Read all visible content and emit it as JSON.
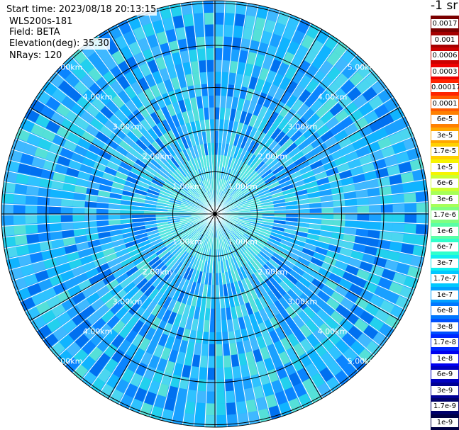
{
  "header": {
    "start_time": "Start time: 2023/08/18 20:13:15",
    "instrument": "WLS200s-181",
    "field": "Field: BETA",
    "elevation": "Elevation(deg): 35.30",
    "nrays": "NRays: 120"
  },
  "colorbar": {
    "unit_title": "-1 sr",
    "levels": [
      {
        "label": "0.0017",
        "color": "#7a0000"
      },
      {
        "label": "0.001",
        "color": "#a50000"
      },
      {
        "label": "0.0006",
        "color": "#cc0000"
      },
      {
        "label": "0.0003",
        "color": "#ee0000"
      },
      {
        "label": "0.00017",
        "color": "#ff2400"
      },
      {
        "label": "0.0001",
        "color": "#ff5a00"
      },
      {
        "label": "6e-5",
        "color": "#ff8000"
      },
      {
        "label": "3e-5",
        "color": "#ffa800"
      },
      {
        "label": "1.7e-5",
        "color": "#ffd000"
      },
      {
        "label": "1e-5",
        "color": "#f6f400"
      },
      {
        "label": "6e-6",
        "color": "#ccff30"
      },
      {
        "label": "3e-6",
        "color": "#a6ff58"
      },
      {
        "label": "1.7e-6",
        "color": "#80ff80"
      },
      {
        "label": "1e-6",
        "color": "#5affa6"
      },
      {
        "label": "6e-7",
        "color": "#30ffcc"
      },
      {
        "label": "3e-7",
        "color": "#10eef0"
      },
      {
        "label": "1.7e-7",
        "color": "#00c8ff"
      },
      {
        "label": "1e-7",
        "color": "#00a0ff"
      },
      {
        "label": "6e-8",
        "color": "#0078ff"
      },
      {
        "label": "3e-8",
        "color": "#0050ff"
      },
      {
        "label": "1.7e-8",
        "color": "#0028ff"
      },
      {
        "label": "1e-8",
        "color": "#0000f0"
      },
      {
        "label": "6e-9",
        "color": "#0000c0"
      },
      {
        "label": "3e-9",
        "color": "#000094"
      },
      {
        "label": "1.7e-9",
        "color": "#00006a"
      },
      {
        "label": "1e-9",
        "color": "#000044"
      }
    ]
  },
  "range_rings": {
    "labels": [
      "1.00km",
      "2.00km",
      "3.00km",
      "4.00km",
      "5.00km"
    ]
  },
  "spokes_deg": [
    0,
    30,
    60,
    90,
    120,
    150,
    180,
    210,
    240,
    270,
    300,
    330
  ],
  "rays": {
    "count": 120,
    "field_palette": [
      "#1aa0ff",
      "#0a84ff",
      "#2ec2ff",
      "#10b4ff",
      "#4bd6f0",
      "#55e0d8",
      "#0070f0",
      "#3fb8ff",
      "#22d0ee"
    ]
  }
}
